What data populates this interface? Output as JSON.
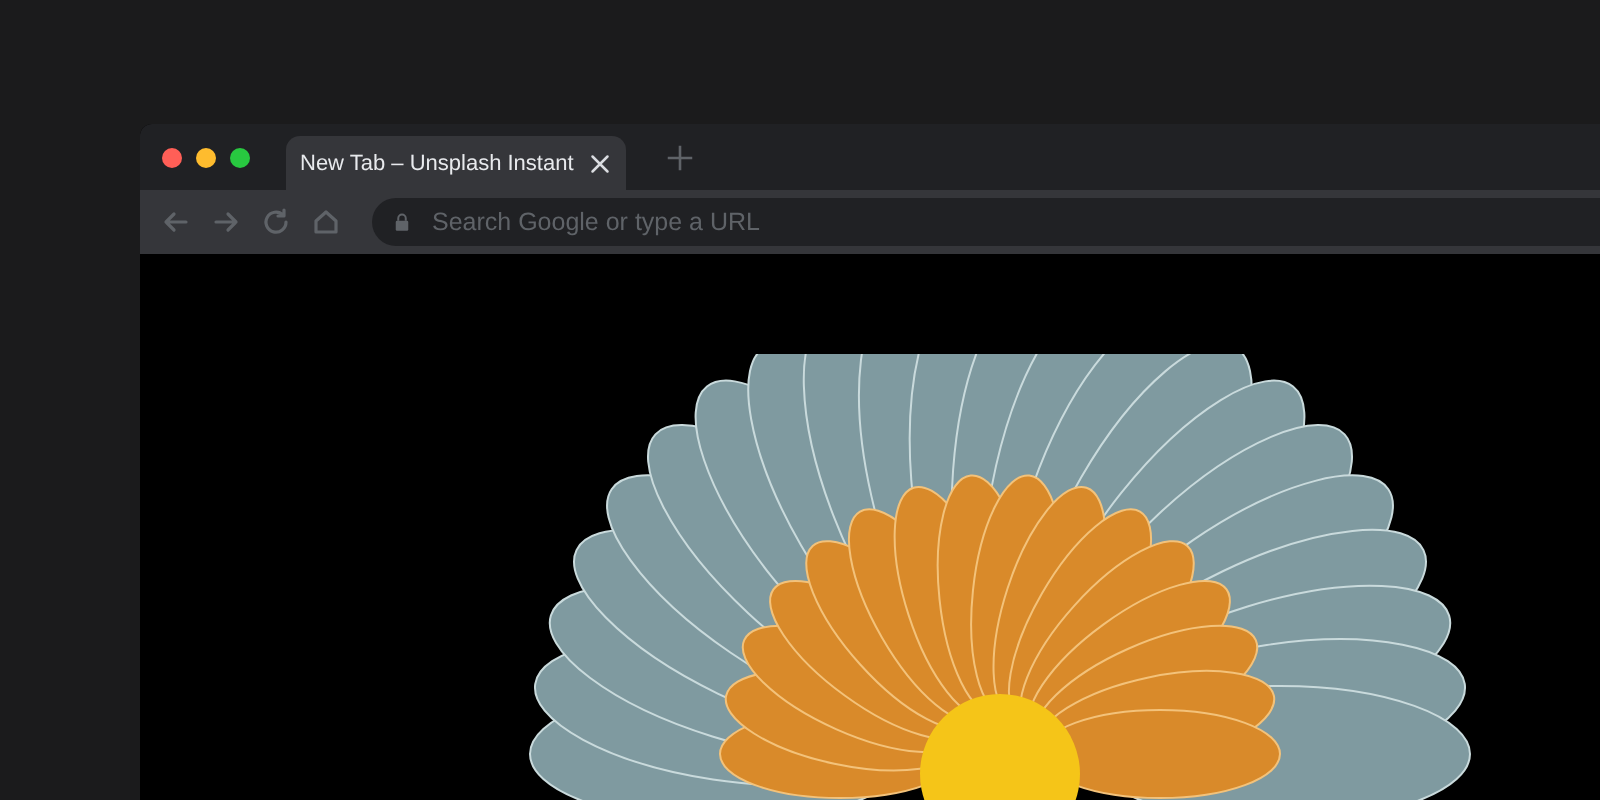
{
  "tabs": [
    {
      "title": "New Tab – Unsplash Instant",
      "selected": true
    }
  ],
  "address_bar": {
    "placeholder": "Search Google or type a URL"
  }
}
